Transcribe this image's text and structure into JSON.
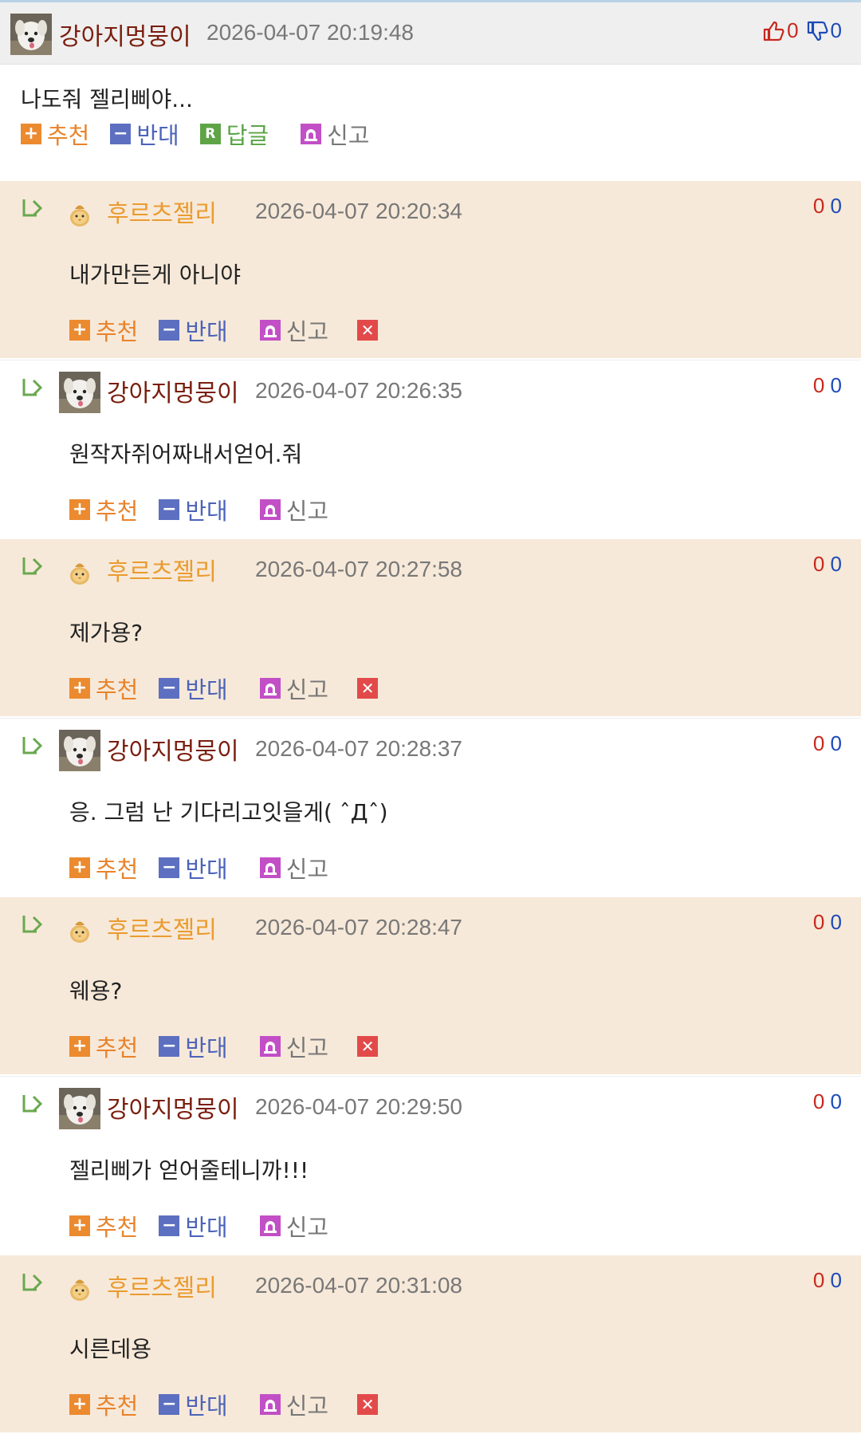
{
  "main": {
    "user": "강아지멍뭉이",
    "date": "2026-04-07 20:19:48",
    "up": "0",
    "down": "0",
    "text": "나도줘 젤리삐야...",
    "actions": {
      "recommend": "추천",
      "oppose": "반대",
      "reply": "답글",
      "report": "신고"
    }
  },
  "comments": [
    {
      "user": "후르츠젤리",
      "date": "2026-04-07 20:20:34",
      "up": "0",
      "down": "0",
      "text": "내가만든게 아니야"
    },
    {
      "user": "강아지멍뭉이",
      "date": "2026-04-07 20:26:35",
      "up": "0",
      "down": "0",
      "text": "원작자쥐어짜내서얻어.줘"
    },
    {
      "user": "후르츠젤리",
      "date": "2026-04-07 20:27:58",
      "up": "0",
      "down": "0",
      "text": "제가용?"
    },
    {
      "user": "강아지멍뭉이",
      "date": "2026-04-07 20:28:37",
      "up": "0",
      "down": "0",
      "text": "응. 그럼 난 기다리고잇을게( ˆДˆ)"
    },
    {
      "user": "후르츠젤리",
      "date": "2026-04-07 20:28:47",
      "up": "0",
      "down": "0",
      "text": "웨용?"
    },
    {
      "user": "강아지멍뭉이",
      "date": "2026-04-07 20:29:50",
      "up": "0",
      "down": "0",
      "text": "젤리삐가 얻어줄테니까!!!"
    },
    {
      "user": "후르츠젤리",
      "date": "2026-04-07 20:31:08",
      "up": "0",
      "down": "0",
      "text": "시른데용"
    }
  ],
  "colors": {
    "accent_orange": "#ec8a2f",
    "accent_blue": "#5c6fc0",
    "reply_green": "#5ea447",
    "report_purple": "#c24fc6",
    "delete_red": "#e24a4a",
    "beige_row": "#f7e9d9"
  },
  "icons": {
    "recommend": "plus-icon",
    "oppose": "minus-icon",
    "reply": "reply-icon",
    "report": "siren-icon",
    "delete": "close-icon",
    "thread": "reply-arrow-icon",
    "thumbs_up": "thumbs-up-icon",
    "thumbs_down": "thumbs-down-icon"
  }
}
